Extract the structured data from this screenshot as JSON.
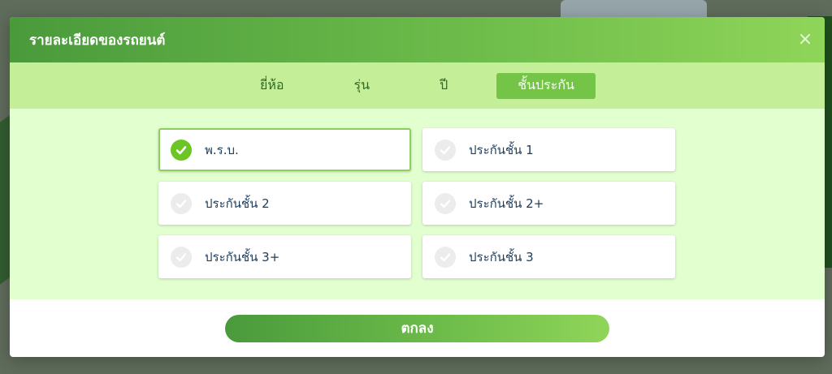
{
  "modal": {
    "title": "รายละเอียดของรถยนต์",
    "close_icon": "close-icon"
  },
  "tabs": [
    {
      "label": "ยี่ห้อ",
      "active": false
    },
    {
      "label": "รุ่น",
      "active": false
    },
    {
      "label": "ปี",
      "active": false
    },
    {
      "label": "ชั้นประกัน",
      "active": true
    }
  ],
  "options": [
    {
      "label": "พ.ร.บ.",
      "selected": true
    },
    {
      "label": "ประกันชั้น 1",
      "selected": false
    },
    {
      "label": "ประกันชั้น 2",
      "selected": false
    },
    {
      "label": "ประกันชั้น 2+",
      "selected": false
    },
    {
      "label": "ประกันชั้น 3+",
      "selected": false
    },
    {
      "label": "ประกันชั้น 3",
      "selected": false
    }
  ],
  "footer": {
    "confirm_label": "ตกลง"
  },
  "colors": {
    "accent": "#6cbb4a",
    "tab_bar": "#c4ee98",
    "options_bg": "#e2ffd0",
    "check_on": "#6cc524"
  }
}
